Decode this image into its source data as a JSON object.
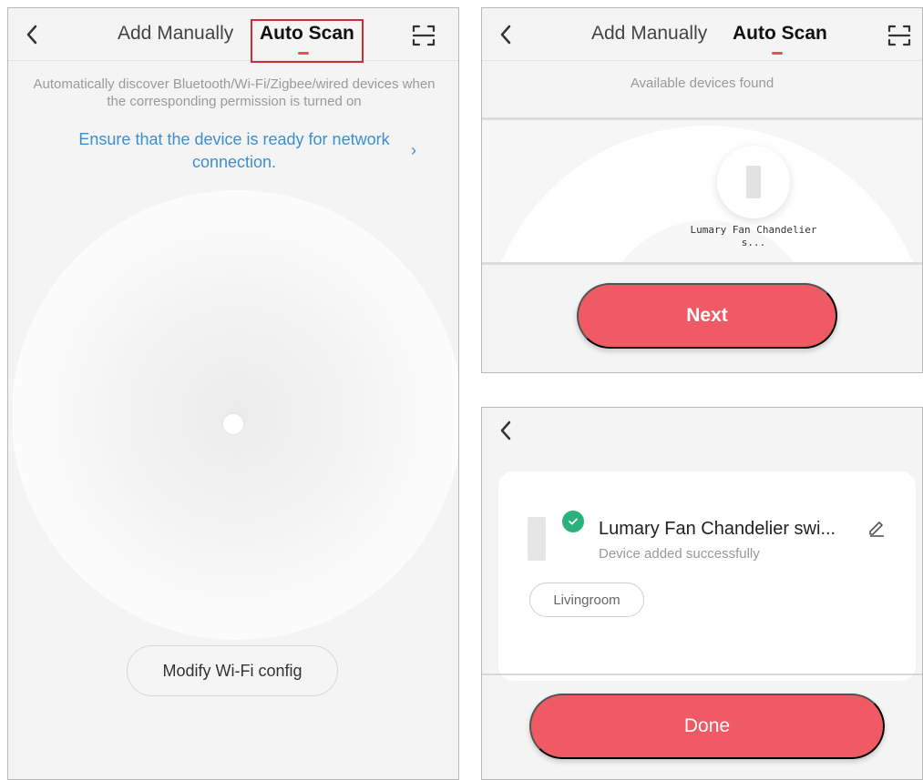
{
  "screen_scan": {
    "tab_manual": "Add Manually",
    "tab_auto": "Auto Scan",
    "hint": "Automatically discover Bluetooth/Wi-Fi/Zigbee/wired devices when the corresponding permission is turned on",
    "ensure_link": "Ensure that the device is ready for network connection.",
    "modify_button": "Modify Wi-Fi config"
  },
  "screen_found": {
    "tab_manual": "Add Manually",
    "tab_auto": "Auto Scan",
    "available": "Available devices found",
    "device_label": "Lumary Fan Chandelier s...",
    "next_button": "Next"
  },
  "screen_done": {
    "device_name": "Lumary Fan Chandelier swi...",
    "status": "Device added successfully",
    "room": "Livingroom",
    "done_button": "Done"
  },
  "icons": {
    "back": "chevron-left-icon",
    "scan": "scan-icon",
    "chevron": "chevron-right-icon",
    "check": "check-icon",
    "edit": "pencil-icon"
  },
  "colors": {
    "accent": "#ef5a64",
    "link": "#3c8fcf",
    "success": "#2bb17c",
    "highlight": "#c8313c"
  }
}
